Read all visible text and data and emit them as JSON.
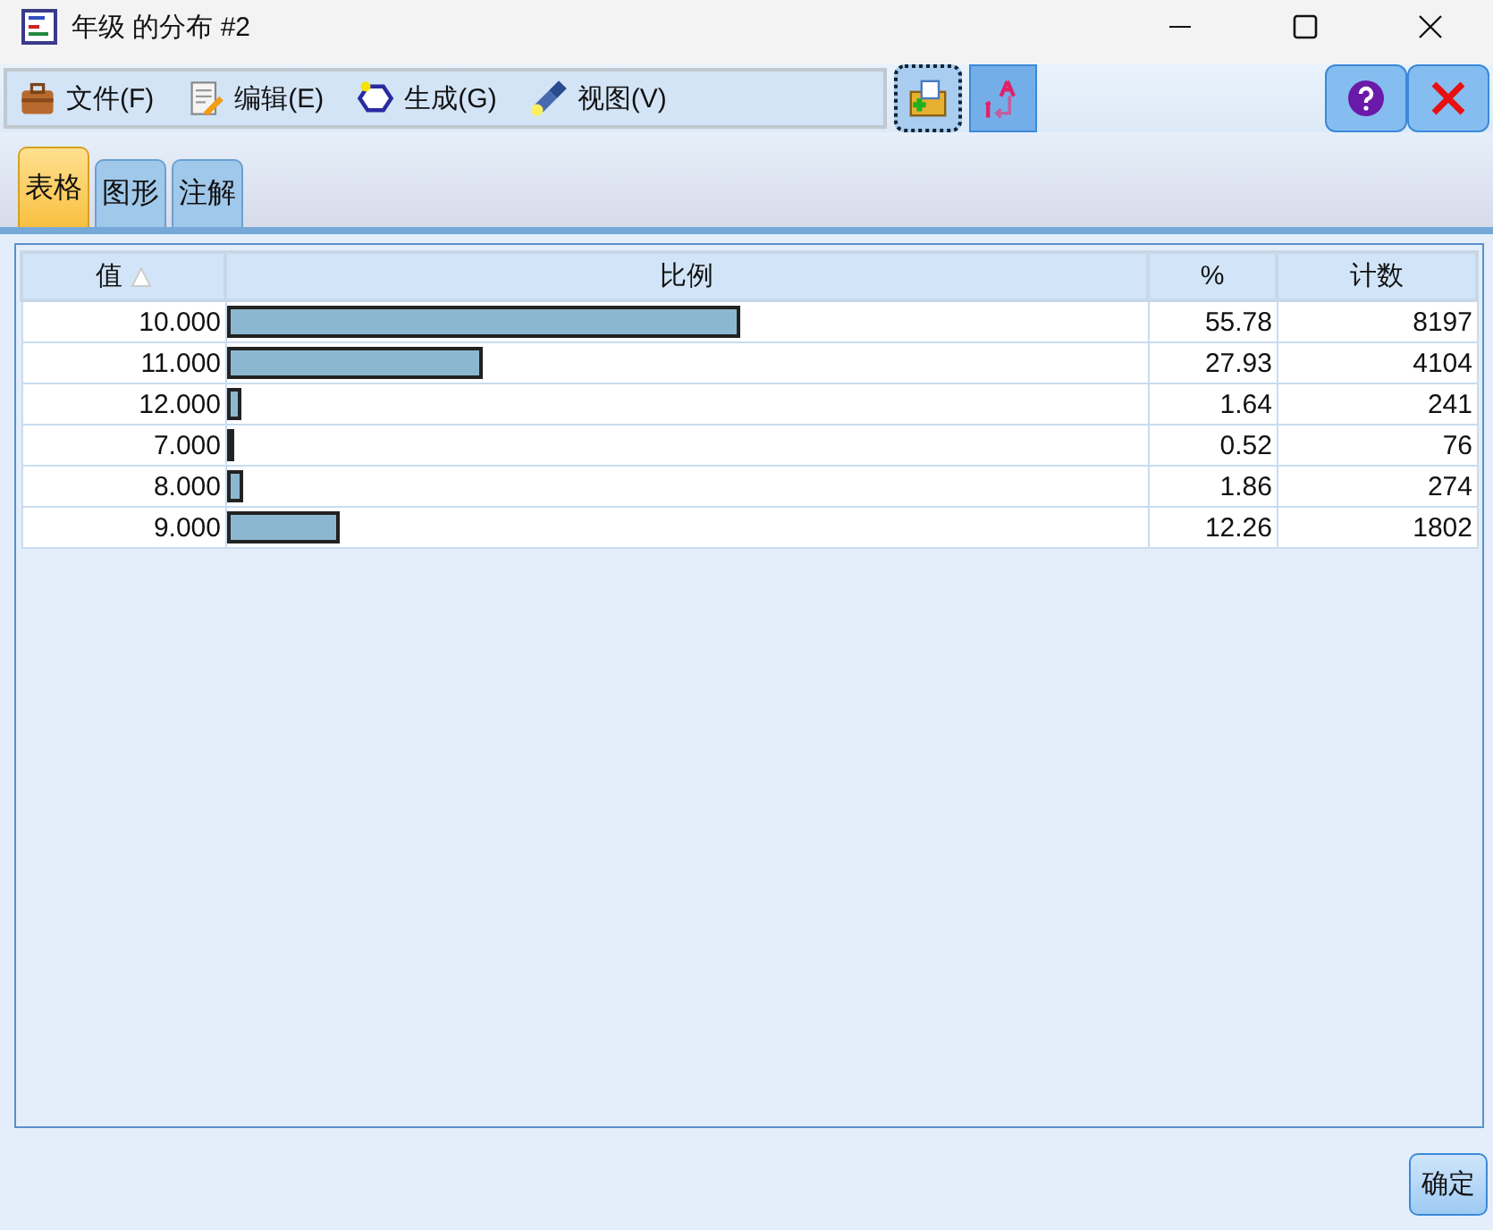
{
  "window": {
    "title": "年级 的分布 #2"
  },
  "menu": [
    {
      "label": "文件(F)"
    },
    {
      "label": "编辑(E)"
    },
    {
      "label": "生成(G)"
    },
    {
      "label": "视图(V)"
    }
  ],
  "toolbar": [
    {
      "selected": true
    },
    {
      "selected": false
    }
  ],
  "tabs": [
    {
      "label": "表格",
      "selected": true
    },
    {
      "label": "图形",
      "selected": false
    },
    {
      "label": "注解",
      "selected": false
    }
  ],
  "table": {
    "columns": [
      {
        "label": "值",
        "sorted": true
      },
      {
        "label": "比例",
        "sorted": false
      },
      {
        "label": "%",
        "sorted": false
      },
      {
        "label": "计数",
        "sorted": false
      }
    ],
    "rows": [
      {
        "value": "10.000",
        "level": 0.5578,
        "percent": "55.78",
        "count": "8197"
      },
      {
        "value": "11.000",
        "level": 0.2793,
        "percent": "27.93",
        "count": "4104"
      },
      {
        "value": "12.000",
        "level": 0.0164,
        "percent": "1.64",
        "count": "241"
      },
      {
        "value": "7.000",
        "level": 0.0052,
        "percent": "0.52",
        "count": "76"
      },
      {
        "value": "8.000",
        "level": 0.0186,
        "percent": "1.86",
        "count": "274"
      },
      {
        "value": "9.000",
        "level": 0.1226,
        "percent": "12.26",
        "count": "1802"
      }
    ]
  },
  "ok_button": "确定"
}
